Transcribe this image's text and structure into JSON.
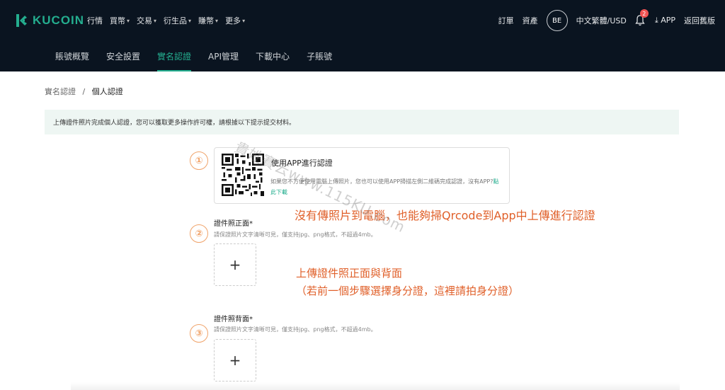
{
  "brand": {
    "name": "KUCOIN",
    "color": "#24ae8f"
  },
  "menu": [
    {
      "label": "行情",
      "caret": false
    },
    {
      "label": "買幣",
      "caret": true
    },
    {
      "label": "交易",
      "caret": true
    },
    {
      "label": "衍生品",
      "caret": true
    },
    {
      "label": "賺幣",
      "caret": true
    },
    {
      "label": "更多",
      "caret": true
    }
  ],
  "right": {
    "orders": "訂單",
    "assets": "資產",
    "avatar": "BE",
    "locale": "中文繁體/USD",
    "notif_count": "2",
    "app": "APP",
    "classic": "返回舊版"
  },
  "tabs": [
    "賬號概覽",
    "安全設置",
    "實名認證",
    "API管理",
    "下載中心",
    "子賬號"
  ],
  "active_tab": "實名認證",
  "breadcrumb": {
    "parent": "實名認證",
    "sep": "/",
    "current": "個人認證"
  },
  "notice": "上傳證件照片完成個人認證，您可以獲取更多操作許可權，請根據以下提示提交材料。",
  "steps": [
    "①",
    "②",
    "③"
  ],
  "app_card": {
    "title": "使用APP進行認證",
    "desc": "如果您不方便使用電腦上傳照片，您也可以使用APP掃描左側二維碼完成認證，沒有APP?",
    "link": "點此下載"
  },
  "front": {
    "label": "證件照正面*",
    "hint": "請保證照片文字清晰可見，僅支持jpg、png格式，不超過4mb。",
    "plus": "+"
  },
  "back": {
    "label": "證件照背面*",
    "hint": "請保證照片文字清晰可見，僅支持jpg、png格式，不超過4mb。",
    "plus": "+"
  },
  "annotations": {
    "line1": "沒有傳照片到電腦，也能夠掃Qrcode到App中上傳進行認證",
    "line2": "上傳證件照正面與背面",
    "line3": "（若前一個步驟選擇身分證，這裡請拍身分證）"
  },
  "watermark": "貴姓賽云www.115KU.com",
  "colors": {
    "accent": "#24ae8f",
    "header_bg": "#0a1420",
    "annotation": "#e0602a",
    "badge": "#f05353"
  }
}
